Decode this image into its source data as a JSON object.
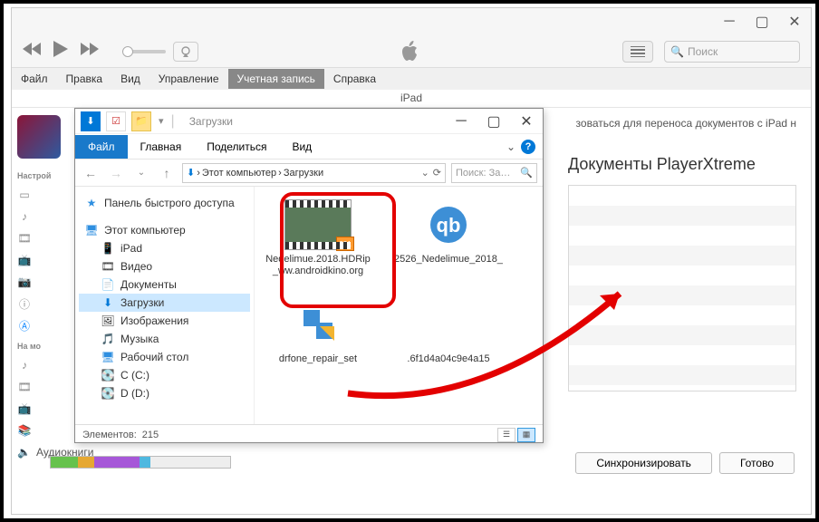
{
  "itunes": {
    "search_placeholder": "Поиск",
    "menu": [
      "Файл",
      "Правка",
      "Вид",
      "Управление",
      "Учетная запись",
      "Справка"
    ],
    "menu_active_index": 4,
    "device_header": "iPad",
    "sidebar": {
      "settings_label": "Настрой",
      "my_label": "На мо",
      "items": [
        {
          "icon": "music",
          "label": ""
        },
        {
          "icon": "movie",
          "label": ""
        },
        {
          "icon": "tv",
          "label": ""
        },
        {
          "icon": "photo",
          "label": ""
        },
        {
          "icon": "info",
          "label": ""
        },
        {
          "icon": "apps",
          "label": ""
        }
      ],
      "items2": [
        {
          "icon": "music",
          "label": ""
        },
        {
          "icon": "movie",
          "label": ""
        },
        {
          "icon": "tv",
          "label": ""
        },
        {
          "icon": "books",
          "label": ""
        },
        {
          "icon": "audiobooks",
          "label": "Аудиокниги"
        }
      ]
    },
    "main": {
      "info_text": "зоваться для переноса документов с iPad н",
      "docs_title": "Документы PlayerXtreme",
      "sync_label": "Синхронизировать",
      "done_label": "Готово"
    },
    "storage_segments": [
      {
        "color": "#66c24d",
        "w": 30
      },
      {
        "color": "#e6a832",
        "w": 18
      },
      {
        "color": "#a657d8",
        "w": 50
      },
      {
        "color": "#4fb8e0",
        "w": 12
      },
      {
        "color": "#e0e0e0",
        "w": 88
      }
    ]
  },
  "explorer": {
    "title": "Загрузки",
    "ribbon": {
      "file": "Файл",
      "home": "Главная",
      "share": "Поделиться",
      "view": "Вид"
    },
    "address": {
      "root": "Этот компьютер",
      "folder": "Загрузки"
    },
    "search_placeholder": "Поиск: За…",
    "nav": {
      "quick_access": "Панель быстрого доступа",
      "this_pc": "Этот компьютер",
      "items": [
        {
          "label": "iPad",
          "icon": "📱"
        },
        {
          "label": "Видео",
          "icon": "🎞"
        },
        {
          "label": "Документы",
          "icon": "📄"
        },
        {
          "label": "Загрузки",
          "icon": "⬇",
          "selected": true
        },
        {
          "label": "Изображения",
          "icon": "🖼"
        },
        {
          "label": "Музыка",
          "icon": "🎵"
        },
        {
          "label": "Рабочий стол",
          "icon": "🖥"
        },
        {
          "label": "C (C:)",
          "icon": "💽"
        },
        {
          "label": "D (D:)",
          "icon": "💽"
        }
      ]
    },
    "files": [
      {
        "name": "Nedelimue.2018.HDRip_ww.androidkino.org",
        "type": "video"
      },
      {
        "name": "2526_Nedelimue_2018_",
        "type": "qb"
      },
      {
        "name": "drfone_repair_set",
        "type": "app"
      },
      {
        "name": ".6f1d4a04c9e4a15",
        "type": "file"
      }
    ],
    "status": {
      "count_label": "Элементов:",
      "count_value": "215"
    }
  }
}
